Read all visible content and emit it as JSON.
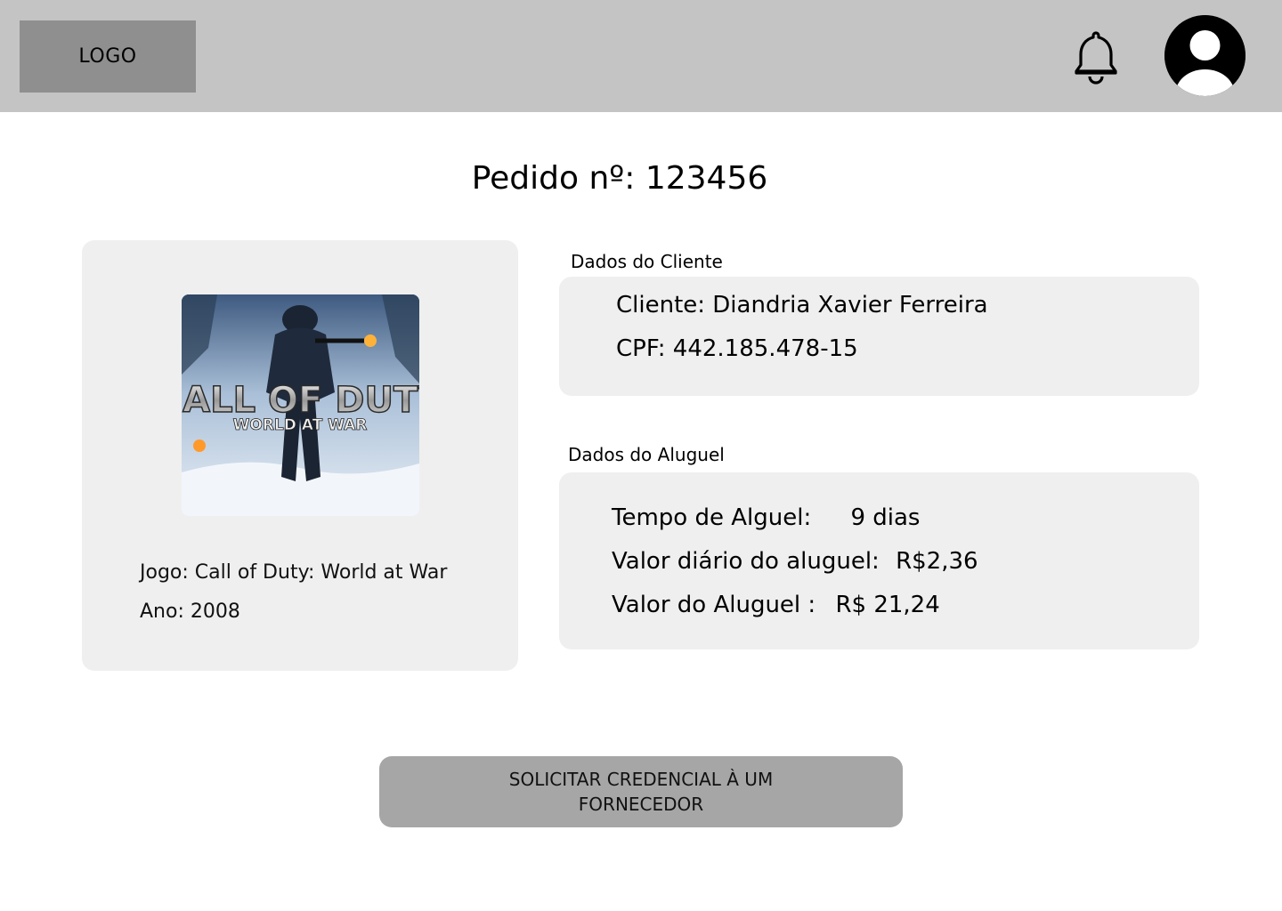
{
  "header": {
    "logo_text": "LOGO",
    "notification_icon": "bell-icon",
    "avatar_icon": "user-avatar-icon"
  },
  "order": {
    "title": "Pedido nº: 123456"
  },
  "game": {
    "cover_title_main": "CALL OF DUTY",
    "cover_title_sub": "WORLD AT WAR",
    "name_label": "Jogo:",
    "name_value": "Call of Duty: World at War",
    "year_label": "Ano:",
    "year_value": "2008"
  },
  "client": {
    "section_label": "Dados do Cliente",
    "name_line": "Cliente: Diandria Xavier Ferreira",
    "cpf_line": "CPF: 442.185.478-15"
  },
  "rental": {
    "section_label": "Dados do Aluguel",
    "duration_label": "Tempo de Alguel:",
    "duration_value": "9 dias",
    "daily_label": "Valor diário do aluguel:",
    "daily_value": "R$2,36",
    "total_label": "Valor do Aluguel :",
    "total_value": "R$ 21,24"
  },
  "actions": {
    "request_button": "SOLICITAR CREDENCIAL À UM FORNECEDOR"
  }
}
